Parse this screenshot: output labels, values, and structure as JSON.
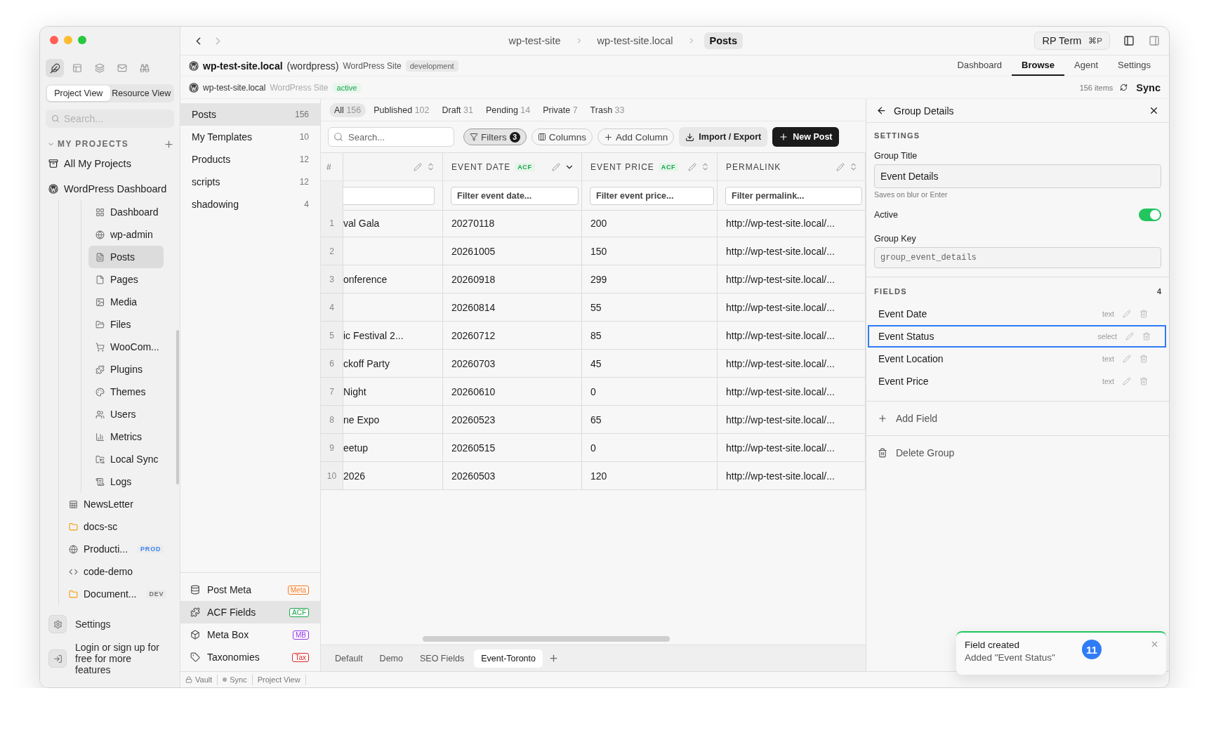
{
  "sidebar": {
    "view_tabs": [
      {
        "label": "Project View",
        "selected": true
      },
      {
        "label": "Resource View",
        "selected": false
      }
    ],
    "search": {
      "placeholder": "Search..."
    },
    "section_title": "MY PROJECTS",
    "projects": [
      {
        "label": "All My Projects"
      },
      {
        "label": "WordPress Dashboard",
        "children": [
          {
            "label": "Dashboard",
            "kind": "page",
            "selected": false
          },
          {
            "label": "wp-admin",
            "kind": "page",
            "selected": false
          },
          {
            "label": "Posts",
            "kind": "page",
            "selected": true
          },
          {
            "label": "Pages",
            "kind": "page",
            "selected": false
          },
          {
            "label": "Media",
            "kind": "page",
            "selected": false
          },
          {
            "label": "Files",
            "kind": "page",
            "selected": false
          },
          {
            "label": "WooCom...",
            "kind": "page",
            "selected": false
          },
          {
            "label": "Plugins",
            "kind": "page",
            "selected": false
          },
          {
            "label": "Themes",
            "kind": "page",
            "selected": false
          },
          {
            "label": "Users",
            "kind": "page",
            "selected": false
          },
          {
            "label": "Metrics",
            "kind": "page",
            "selected": false
          },
          {
            "label": "Local Sync",
            "kind": "page",
            "selected": false
          },
          {
            "label": "Logs",
            "kind": "page",
            "selected": false
          },
          {
            "label": "NewsLetter",
            "kind": "project",
            "selected": false
          },
          {
            "label": "docs-sc",
            "kind": "project",
            "selected": false
          },
          {
            "label": "Producti...",
            "kind": "project",
            "selected": false,
            "badge": "PROD",
            "color": "#3b82f6"
          },
          {
            "label": "code-demo",
            "kind": "project",
            "selected": false
          },
          {
            "label": "Document...",
            "kind": "project",
            "selected": false,
            "badge": "DEV",
            "color": "#737373"
          }
        ]
      }
    ],
    "settings": "Settings",
    "login": "Login or sign up for free for more features"
  },
  "topbar": {
    "breadcrumbs": [
      {
        "label": "wp-test-site",
        "selected": false
      },
      {
        "label": "wp-test-site.local",
        "selected": false
      },
      {
        "label": "Posts",
        "selected": true
      }
    ],
    "terminal": {
      "label": "RP Term",
      "shortcut": "⌘P"
    }
  },
  "site_header": {
    "name": "wp-test-site.local",
    "platform": "(wordpress)",
    "type": "WordPress Site",
    "environment": "development",
    "tabs": [
      {
        "label": "Dashboard",
        "selected": false
      },
      {
        "label": "Browse",
        "selected": true
      },
      {
        "label": "Agent",
        "selected": false
      },
      {
        "label": "Settings",
        "selected": false
      }
    ]
  },
  "site_status": {
    "name": "wp-test-site.local",
    "type": "WordPress Site",
    "status": "active",
    "count": "156 items",
    "sync": "Sync"
  },
  "collections": [
    {
      "label": "Posts",
      "count": "156",
      "selected": true
    },
    {
      "label": "My Templates",
      "count": "10",
      "selected": false
    },
    {
      "label": "Products",
      "count": "12",
      "selected": false
    },
    {
      "label": "scripts",
      "count": "12",
      "selected": false
    },
    {
      "label": "shadowing",
      "count": "4",
      "selected": false
    }
  ],
  "sources": [
    {
      "label": "Post Meta",
      "tag": "Meta",
      "color": "#f97316",
      "selected": false
    },
    {
      "label": "ACF Fields",
      "tag": "ACF",
      "color": "#16a34a",
      "selected": true
    },
    {
      "label": "Meta Box",
      "tag": "MB",
      "color": "#9333ea",
      "selected": false
    },
    {
      "label": "Taxonomies",
      "tag": "Tax",
      "color": "#dc2626",
      "selected": false
    }
  ],
  "status_tabs": [
    {
      "label": "All",
      "count": "156",
      "selected": true
    },
    {
      "label": "Published",
      "count": "102",
      "selected": false
    },
    {
      "label": "Draft",
      "count": "31",
      "selected": false
    },
    {
      "label": "Pending",
      "count": "14",
      "selected": false
    },
    {
      "label": "Private",
      "count": "7",
      "selected": false
    },
    {
      "label": "Trash",
      "count": "33",
      "selected": false
    }
  ],
  "toolbar": {
    "search_placeholder": "Search...",
    "filters": {
      "label": "Filters",
      "count": "3",
      "active": true
    },
    "columns": "Columns",
    "add_column": "Add Column",
    "import_export": "Import / Export",
    "new_post": "New Post"
  },
  "table": {
    "number_heading": "#",
    "columns": [
      {
        "sorted": false
      },
      {
        "label": "EVENT DATE",
        "tag": "ACF",
        "sorted": true,
        "filter_placeholder": "Filter event date..."
      },
      {
        "label": "EVENT PRICE",
        "tag": "ACF",
        "sorted": false,
        "filter_placeholder": "Filter event price..."
      },
      {
        "label": "PERMALINK",
        "sorted": false,
        "filter_placeholder": "Filter permalink..."
      }
    ],
    "rows": [
      {
        "number": "1",
        "cells": [
          "val Gala",
          "20270118",
          "200",
          "http://wp-test-site.local/..."
        ]
      },
      {
        "number": "2",
        "cells": [
          "",
          "20261005",
          "150",
          "http://wp-test-site.local/..."
        ]
      },
      {
        "number": "3",
        "cells": [
          "onference",
          "20260918",
          "299",
          "http://wp-test-site.local/..."
        ]
      },
      {
        "number": "4",
        "cells": [
          "",
          "20260814",
          "55",
          "http://wp-test-site.local/..."
        ]
      },
      {
        "number": "5",
        "cells": [
          "ic Festival 2...",
          "20260712",
          "85",
          "http://wp-test-site.local/..."
        ]
      },
      {
        "number": "6",
        "cells": [
          "ckoff Party",
          "20260703",
          "45",
          "http://wp-test-site.local/..."
        ]
      },
      {
        "number": "7",
        "cells": [
          "Night",
          "20260610",
          "0",
          "http://wp-test-site.local/..."
        ]
      },
      {
        "number": "8",
        "cells": [
          "ne Expo",
          "20260523",
          "65",
          "http://wp-test-site.local/..."
        ]
      },
      {
        "number": "9",
        "cells": [
          "eetup",
          "20260515",
          "0",
          "http://wp-test-site.local/..."
        ]
      },
      {
        "number": "10",
        "cells": [
          "2026",
          "20260503",
          "120",
          "http://wp-test-site.local/..."
        ]
      }
    ]
  },
  "view_tabs": [
    {
      "label": "Default",
      "selected": false
    },
    {
      "label": "Demo",
      "selected": false
    },
    {
      "label": "SEO Fields",
      "selected": false
    },
    {
      "label": "Event-Toronto",
      "selected": true
    }
  ],
  "status_bar": [
    "Vault",
    "Sync",
    "Project View"
  ],
  "panel": {
    "title": "Group Details",
    "settings_heading": "SETTINGS",
    "title_label": "Group Title",
    "title_value": "Event Details",
    "title_hint": "Saves on blur or Enter",
    "active_label": "Active",
    "active": true,
    "key_label": "Group Key",
    "key_value": "group_event_details",
    "fields_heading": "FIELDS",
    "fields_count": "4",
    "fields": [
      {
        "name": "Event Date",
        "type": "text",
        "selected": false
      },
      {
        "name": "Event Status",
        "type": "select",
        "selected": true
      },
      {
        "name": "Event Location",
        "type": "text",
        "selected": false
      },
      {
        "name": "Event Price",
        "type": "text",
        "selected": false
      }
    ],
    "add_field": "Add Field",
    "delete_group": "Delete Group"
  },
  "toast": {
    "title": "Field created",
    "message": "Added \"Event Status\"",
    "count": "11"
  }
}
